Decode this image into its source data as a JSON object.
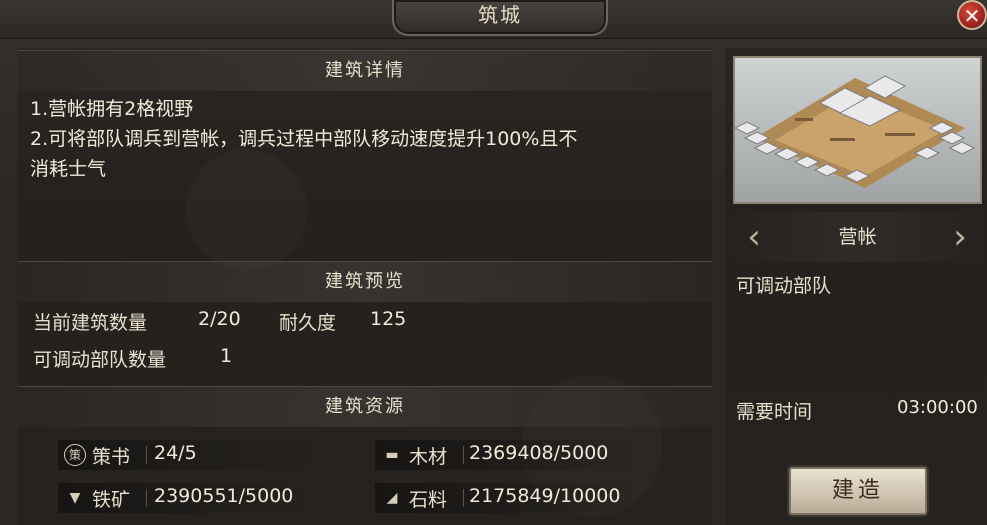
{
  "window": {
    "title": "筑城",
    "close_glyph": "✕"
  },
  "details": {
    "header": "建筑详情",
    "lines": [
      "1.营帐拥有2格视野",
      "2.可将部队调兵到营帐，调兵过程中部队移动速度提升100%且不",
      "消耗士气"
    ]
  },
  "preview": {
    "header": "建筑预览",
    "current_count_label": "当前建筑数量",
    "current_count_value": "2/20",
    "durability_label": "耐久度",
    "durability_value": "125",
    "troops_label": "可调动部队数量",
    "troops_value": "1"
  },
  "resources": {
    "header": "建筑资源",
    "items": [
      {
        "label": "策书",
        "value": "24/5",
        "icon": "book-seal-icon",
        "glyph": "策"
      },
      {
        "label": "木材",
        "value": "2369408/5000",
        "icon": "wood-icon",
        "glyph": "▬"
      },
      {
        "label": "铁矿",
        "value": "2390551/5000",
        "icon": "anvil-icon",
        "glyph": "▼"
      },
      {
        "label": "石料",
        "value": "2175849/10000",
        "icon": "stone-icon",
        "glyph": "◢"
      }
    ]
  },
  "building": {
    "name": "营帐",
    "ability": "可调动部队",
    "time_label": "需要时间",
    "time_value": "03:00:00",
    "build_button": "建造"
  },
  "colors": {
    "accent_text": "#e8dfcc",
    "button_bg": "#e9e2d3",
    "close_red": "#a2241b"
  }
}
